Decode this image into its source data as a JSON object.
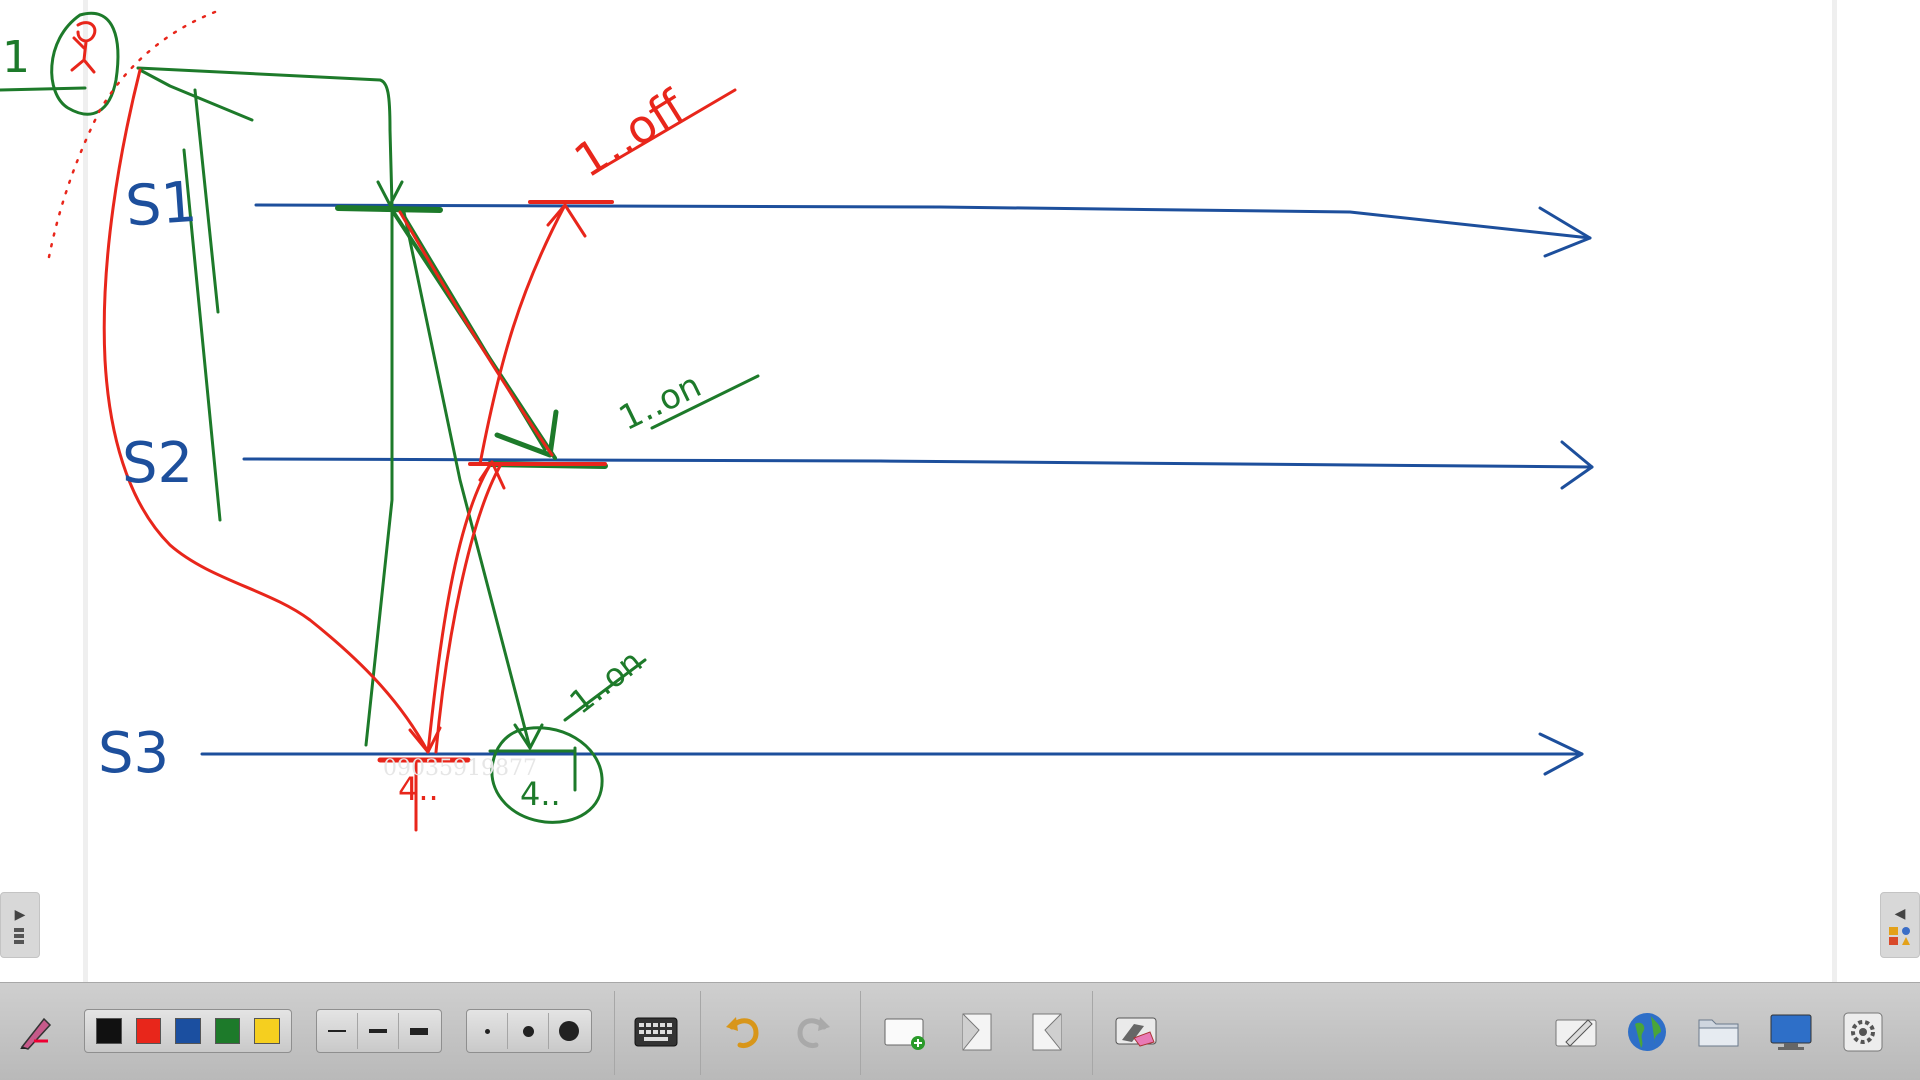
{
  "board": {
    "labels": [
      "S1",
      "S2",
      "S3"
    ],
    "annotations": {
      "ann1": "1..off",
      "ann2": "1..on",
      "ann3": "1..on",
      "ann4": "4..",
      "ann5": "4..",
      "ann6": "1"
    },
    "watermark": "09035919877"
  },
  "toolbar": {
    "colors": [
      "#111111",
      "#e8261b",
      "#1b4fa0",
      "#1d7a2a",
      "#f5cf1f"
    ],
    "icons": [
      "pen-tool-icon",
      "keyboard-icon",
      "undo-icon",
      "redo-icon",
      "add-page-icon",
      "previous-page-icon",
      "next-page-icon",
      "eraser-icon",
      "pen-mode-icon",
      "web-browser-icon",
      "folder-icon",
      "desktop-icon",
      "settings-icon"
    ]
  }
}
